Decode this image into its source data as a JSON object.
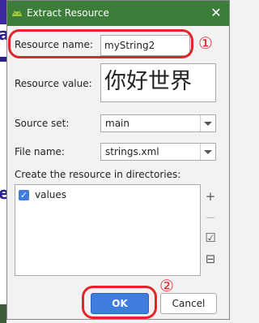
{
  "window": {
    "title": "Extract Resource",
    "close_glyph": "✕"
  },
  "form": {
    "resource_name_label": "Resource name:",
    "resource_name_value": "myString2",
    "resource_value_label": "Resource value:",
    "resource_value_value": "你好世界",
    "source_set_label": "Source set:",
    "source_set_value": "main",
    "file_name_label": "File name:",
    "file_name_value": "strings.xml",
    "directories_label": "Create the resource in directories:",
    "directories": [
      {
        "name": "values",
        "checked": true
      }
    ]
  },
  "side_buttons": {
    "add": "+",
    "remove": "−",
    "select_all": "☑",
    "deselect_all": "⊟"
  },
  "buttons": {
    "ok": "OK",
    "cancel": "Cancel"
  },
  "annotations": {
    "marker_1": "①",
    "marker_2": "②"
  },
  "background_fragments": [
    "a",
    "e"
  ],
  "colors": {
    "titlebar": "#3c7d3a",
    "accent": "#3f7ddd",
    "annotation": "#e3242b"
  },
  "icons": {
    "title": "android-icon",
    "close": "close-icon",
    "add": "plus-icon",
    "remove": "minus-icon",
    "select_all": "select-all-icon",
    "deselect_all": "deselect-all-icon"
  }
}
